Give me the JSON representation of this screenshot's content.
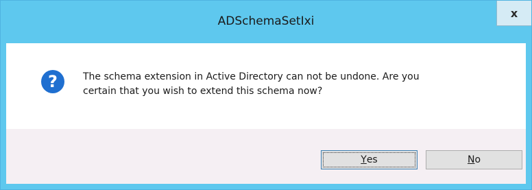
{
  "window": {
    "title": "ADSchemaSetIxi",
    "close_label": "x"
  },
  "dialog": {
    "icon": "question-icon",
    "message_line1": "The schema extension in Active Directory can not be undone. Are you",
    "message_line2": "certain that you wish to extend this schema now?"
  },
  "buttons": {
    "yes_mnemonic": "Y",
    "yes_rest": "es",
    "no_mnemonic": "N",
    "no_rest": "o"
  },
  "colors": {
    "titlebar": "#5ec8ee",
    "icon_blue": "#1f6fd0",
    "footer": "#f5eff3"
  }
}
